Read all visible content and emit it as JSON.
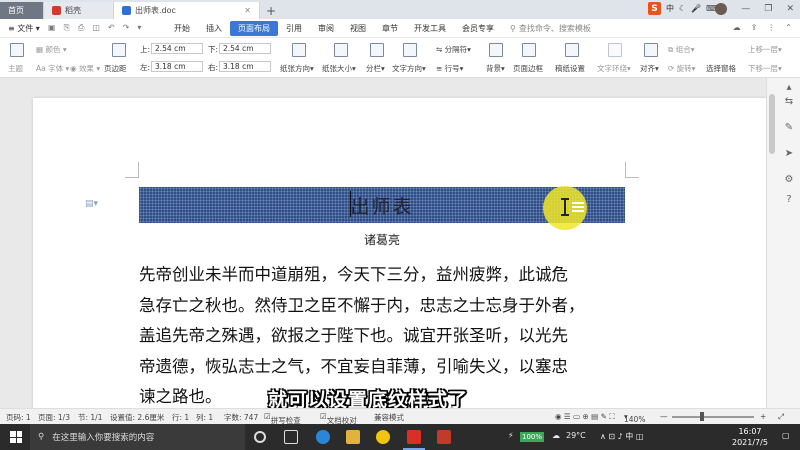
{
  "tabs": {
    "home": "首页",
    "daoke": "稻壳",
    "doc": "出师表.doc",
    "add": "+"
  },
  "ime": {
    "logo": "S",
    "mode": "中"
  },
  "menu": {
    "file": "文件",
    "items": [
      "开始",
      "插入",
      "页面布局",
      "引用",
      "审阅",
      "视图",
      "章节",
      "开发工具",
      "会员专享"
    ],
    "active_index": 2,
    "search": "查找命令、搜索模板"
  },
  "ribbon": {
    "theme": "主题",
    "colors": "颜色",
    "fonts": "字体",
    "effects": "效果",
    "margins": "页边距",
    "top_label": "上:",
    "top_value": "2.54 cm",
    "bottom_label": "下:",
    "bottom_value": "2.54 cm",
    "left_label": "左:",
    "left_value": "3.18 cm",
    "right_label": "右:",
    "right_value": "3.18 cm",
    "orientation": "纸张方向",
    "size": "纸张大小",
    "columns": "分栏",
    "text_direction": "文字方向",
    "line_numbers": "行号",
    "breaks": "分隔符",
    "background": "背景",
    "page_border": "页面边框",
    "manuscript": "稿纸设置",
    "wrap": "文字环绕",
    "align": "对齐",
    "rotate": "旋转",
    "select_pane": "选择窗格",
    "group": "组合",
    "bring_forward": "上移一层",
    "send_backward": "下移一层"
  },
  "document": {
    "heading": "出师表",
    "author": "诸葛亮",
    "lines": [
      "先帝创业未半而中道崩殂，今天下三分，益州疲弊，此诚危",
      "急存亡之秋也。然侍卫之臣不懈于内，忠志之士忘身于外者，",
      "盖追先帝之殊遇，欲报之于陛下也。诚宜开张圣听，以光先",
      "帝遗德，恢弘志士之气，不宜妄自菲薄，引喻失义，以塞忠",
      "谏之路也。"
    ],
    "heading_bg": "#2f4f88"
  },
  "subtitle": "就可以设置底纹样式了",
  "status": {
    "page_num": "页码: 1",
    "pages": "页面: 1/3",
    "section": "节: 1/1",
    "position": "设置值: 2.6厘米",
    "row": "行: 1",
    "col": "列: 1",
    "words": "字数: 747",
    "spell": "拼写检查",
    "doc_check": "文档校对",
    "compat": "兼容模式",
    "zoom": "140%"
  },
  "taskbar": {
    "search_placeholder": "在这里输入你要搜索的内容",
    "battery": "100%",
    "weather": "29°C",
    "time": "16:07",
    "date": "2021/7/5"
  }
}
